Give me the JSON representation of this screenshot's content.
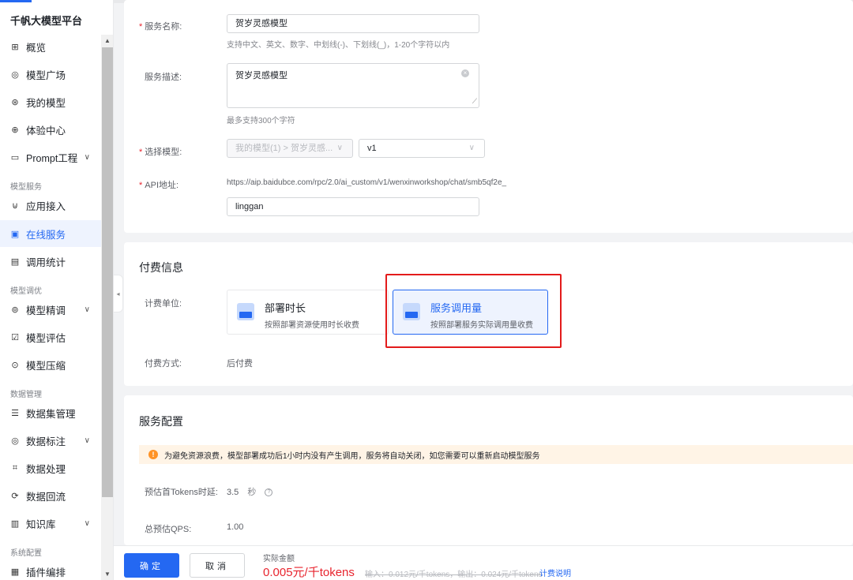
{
  "sidebar": {
    "brand": "千帆大模型平台",
    "items": [
      {
        "label": "概览",
        "icon": "grid-icon",
        "glyph": "⊞"
      },
      {
        "label": "模型广场",
        "icon": "model-square-icon",
        "glyph": "◎"
      },
      {
        "label": "我的模型",
        "icon": "my-model-icon",
        "glyph": "⊛"
      },
      {
        "label": "体验中心",
        "icon": "experience-icon",
        "glyph": "⊕"
      },
      {
        "label": "Prompt工程",
        "icon": "prompt-icon",
        "glyph": "▭"
      },
      {
        "label": "应用接入",
        "icon": "app-access-icon",
        "glyph": "⊍"
      },
      {
        "label": "在线服务",
        "icon": "online-service-icon",
        "glyph": "▣"
      },
      {
        "label": "调用统计",
        "icon": "stats-icon",
        "glyph": "▤"
      },
      {
        "label": "模型精调",
        "icon": "finetune-icon",
        "glyph": "⊚"
      },
      {
        "label": "模型评估",
        "icon": "evaluate-icon",
        "glyph": "☑"
      },
      {
        "label": "模型压缩",
        "icon": "compress-icon",
        "glyph": "⊙"
      },
      {
        "label": "数据集管理",
        "icon": "dataset-icon",
        "glyph": "☰"
      },
      {
        "label": "数据标注",
        "icon": "annotate-icon",
        "glyph": "◎"
      },
      {
        "label": "数据处理",
        "icon": "process-icon",
        "glyph": "⌗"
      },
      {
        "label": "数据回流",
        "icon": "reflow-icon",
        "glyph": "⟳"
      },
      {
        "label": "知识库",
        "icon": "knowledge-icon",
        "glyph": "▥"
      },
      {
        "label": "插件编排",
        "icon": "plugin-icon",
        "glyph": "▦"
      }
    ],
    "groups": {
      "model_service": "模型服务",
      "model_tuning": "模型调优",
      "data_management": "数据管理",
      "system_config": "系统配置"
    },
    "chevron": "∨"
  },
  "form": {
    "service_name": {
      "label": "服务名称:",
      "value": "贺岁灵感模型",
      "hint": "支持中文、英文、数字、中划线(-)、下划线(_)，1-20个字符以内"
    },
    "service_desc": {
      "label": "服务描述:",
      "value": "贺岁灵感模型",
      "hint": "最多支持300个字符"
    },
    "model_select": {
      "label": "选择模型:",
      "model_value": "我的模型(1) > 贺岁灵感...",
      "version_value": "v1"
    },
    "api": {
      "label": "API地址:",
      "prefix": "https://aip.baidubce.com/rpc/2.0/ai_custom/v1/wenxinworkshop/chat/smb5qf2e_",
      "suffix_value": "linggan"
    }
  },
  "billing": {
    "title": "付费信息",
    "unit_label": "计费单位:",
    "options": [
      {
        "title": "部署时长",
        "desc": "按照部署资源使用时长收费",
        "selected": false
      },
      {
        "title": "服务调用量",
        "desc": "按照部署服务实际调用量收费",
        "selected": true
      }
    ],
    "method_label": "付费方式:",
    "method_value": "后付费"
  },
  "service_config": {
    "title": "服务配置",
    "warning": "为避免资源浪费，模型部署成功后1小时内没有产生调用，服务将自动关闭，如您需要可以重新启动模型服务",
    "first_token_label": "预估首Tokens时延:",
    "first_token_value": "3.5",
    "first_token_unit": "秒",
    "qps_label": "总预估QPS:",
    "qps_value": "1.00"
  },
  "footer": {
    "confirm": "确定",
    "cancel": "取消",
    "amount_label": "实际金额",
    "amount": "0.005元/千tokens",
    "detail": "输入：0.012元/千tokens，输出：0.024元/千tokens",
    "calc_link": "计费说明"
  },
  "colors": {
    "primary": "#2468f2",
    "danger": "#e8242e",
    "warning": "#ff9326",
    "highlight_box": "#e31b1b"
  }
}
